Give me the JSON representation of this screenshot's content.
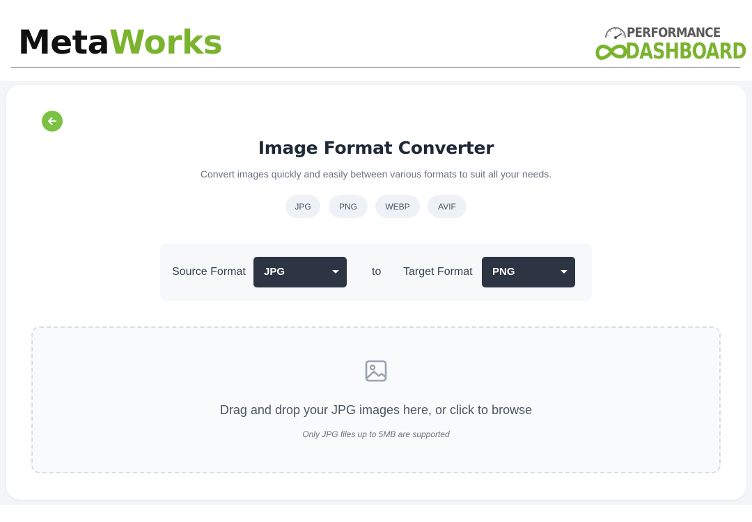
{
  "header": {
    "brand_part1": "Meta",
    "brand_part2": "Works",
    "logo_line1": "PERFORMANCE",
    "logo_line2": "DASHBOARD"
  },
  "converter": {
    "title": "Image Format Converter",
    "subtitle": "Convert images quickly and easily between various formats to suit all your needs.",
    "formats": [
      "JPG",
      "PNG",
      "WEBP",
      "AVIF"
    ],
    "source_label": "Source Format",
    "source_value": "JPG",
    "to_label": "to",
    "target_label": "Target Format",
    "target_value": "PNG"
  },
  "dropzone": {
    "text": "Drag and drop your JPG images here, or click to browse",
    "hint": "Only JPG files up to 5MB are supported"
  },
  "icons": {
    "back": "arrow-left-icon",
    "upload": "image-icon",
    "select_caret": "caret-down-icon"
  },
  "colors": {
    "accent_green": "#7cc242",
    "brand_green": "#7ab32e",
    "select_bg": "#2d3443",
    "title_text": "#1f2937"
  }
}
